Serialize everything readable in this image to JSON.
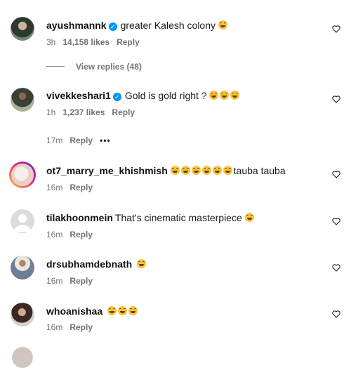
{
  "comments": [
    {
      "username": "ayushmannk",
      "verified": true,
      "text": "greater Kalesh colony",
      "emoji": 1,
      "time": "3h",
      "likes": "14,158 likes",
      "reply": "Reply",
      "view_replies": "View replies (48)"
    },
    {
      "username": "vivekkeshari1",
      "verified": true,
      "text": "Gold is gold right ?",
      "emoji": 3,
      "time": "1h",
      "likes": "1,237 likes",
      "reply": "Reply"
    },
    {
      "time": "17m",
      "reply": "Reply",
      "more": "•••"
    },
    {
      "username": "ot7_marry_me_khishmish",
      "text": "tauba tauba",
      "emoji": 6,
      "time": "16m",
      "reply": "Reply"
    },
    {
      "username": "tilakhoonmein",
      "text": "That's cinematic masterpiece",
      "emoji": 1,
      "time": "16m",
      "reply": "Reply"
    },
    {
      "username": "drsubhamdebnath",
      "text": "",
      "emoji": 1,
      "time": "16m",
      "reply": "Reply"
    },
    {
      "username": "whoanishaa",
      "text": "",
      "emoji": 3,
      "time": "16m",
      "reply": "Reply"
    }
  ]
}
